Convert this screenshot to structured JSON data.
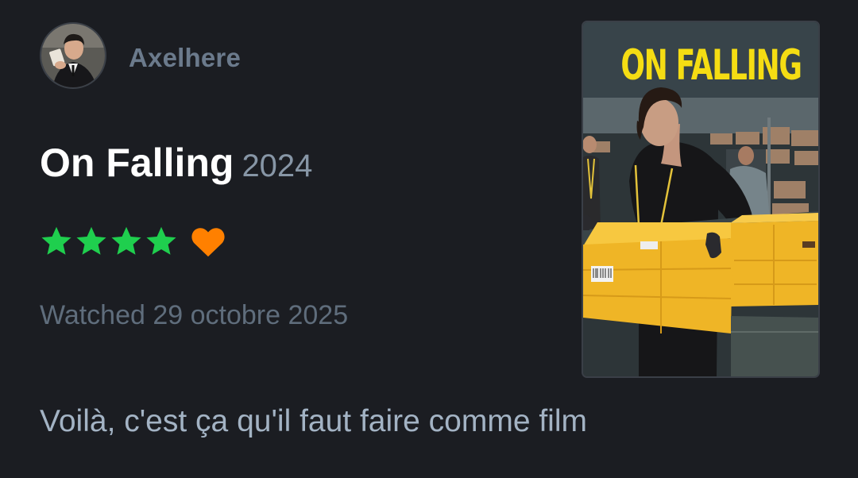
{
  "user": {
    "username": "Axelhere",
    "avatar_icon": "avatar-photo"
  },
  "film": {
    "title": "On Falling",
    "year": "2024",
    "poster_title": "ON FALLING"
  },
  "rating": {
    "stars": 4,
    "max_stars": 5,
    "star_color": "#1fcf4e",
    "liked": true,
    "heart_color": "#ff8000"
  },
  "watched": {
    "text": "Watched 29 octobre 2025"
  },
  "review": {
    "text": "Voilà, c'est ça qu'il faut faire comme film"
  }
}
